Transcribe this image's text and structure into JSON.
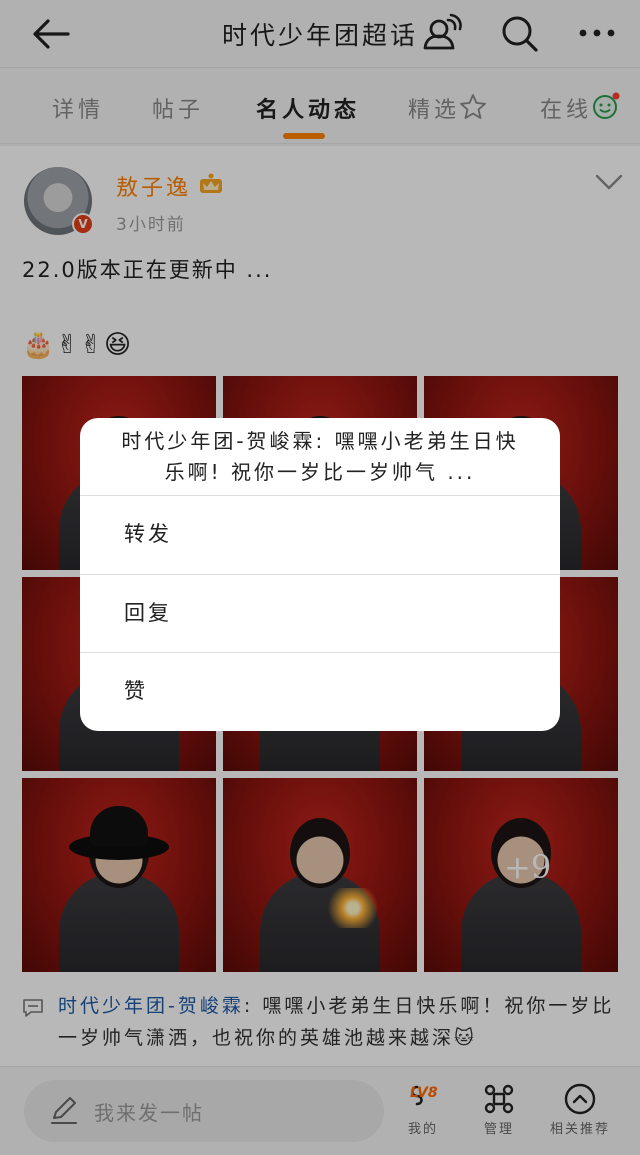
{
  "header": {
    "title": "时代少年团超话"
  },
  "tabs": [
    {
      "label": "详情"
    },
    {
      "label": "帖子"
    },
    {
      "label": "名人动态"
    },
    {
      "label": "精选"
    },
    {
      "label": "在线"
    }
  ],
  "post": {
    "author": "敖子逸",
    "avatar_badge": "V",
    "time": "3小时前",
    "text": "22.0版本正在更新中 ...",
    "emojis": "🎂✌✌😆",
    "more_photos": "+9",
    "comment": {
      "name": "时代少年团-贺峻霖",
      "separator": ": ",
      "text": "嘿嘿小老弟生日快乐啊！祝你一岁比一岁帅气潇洒，也祝你的英雄池越来越深",
      "emoji": "🐱"
    }
  },
  "bottom": {
    "composer_placeholder": "我来发一帖",
    "level_badge": "LV8",
    "nav": [
      {
        "label": "我的"
      },
      {
        "label": "管理"
      },
      {
        "label": "相关推荐"
      }
    ]
  },
  "dialog": {
    "title": "时代少年团-贺峻霖: 嘿嘿小老弟生日快乐啊! 祝你一岁比一岁帅气 ...",
    "items": [
      {
        "label": "转发"
      },
      {
        "label": "回复"
      },
      {
        "label": "赞"
      }
    ]
  },
  "colors": {
    "accent": "#ff8200",
    "link": "#1f5aa6",
    "photo_red": "#b71c14"
  }
}
